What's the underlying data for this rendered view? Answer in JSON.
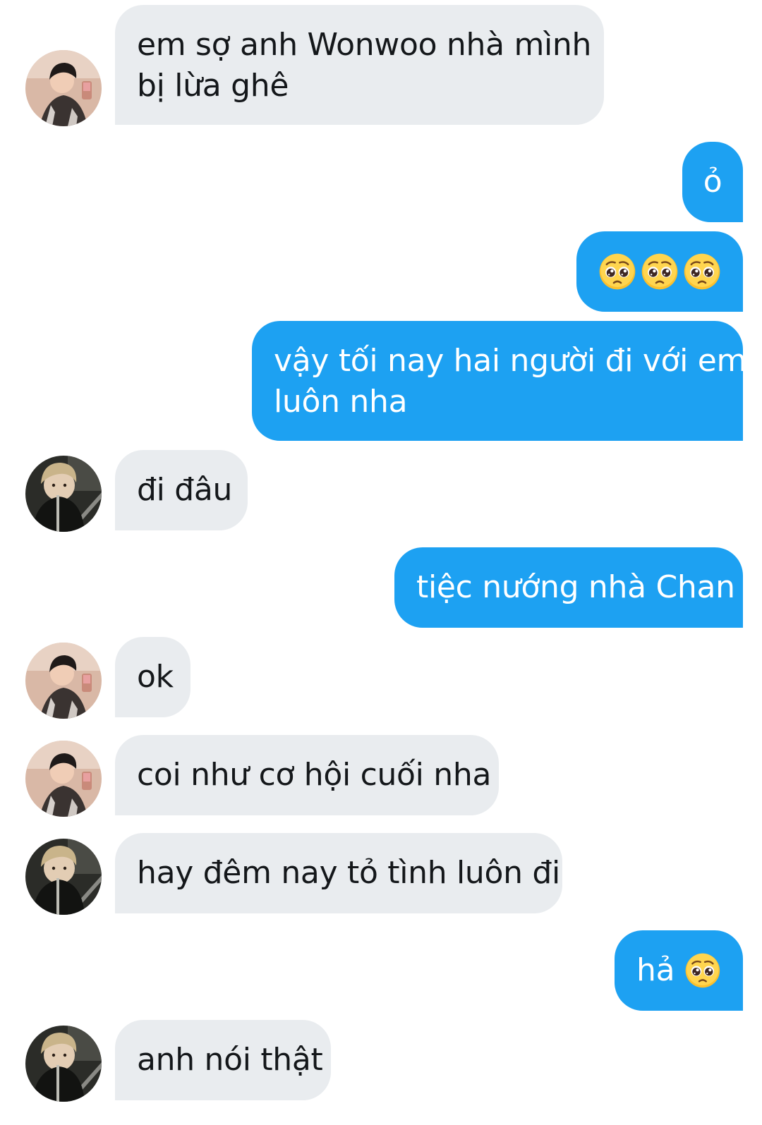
{
  "messages": [
    {
      "side": "in",
      "avatar": "avatar-a",
      "text_lines": [
        "em sợ anh Wonwoo nhà mình",
        "bị lừa ghê"
      ]
    },
    {
      "side": "out",
      "text": "ỏ"
    },
    {
      "side": "out",
      "emojis": [
        "pleading-face",
        "pleading-face",
        "pleading-face"
      ]
    },
    {
      "side": "out",
      "text_lines": [
        "vậy tối nay hai người đi với em",
        "luôn nha"
      ]
    },
    {
      "side": "in",
      "avatar": "avatar-b",
      "text": "đi đâu"
    },
    {
      "side": "out",
      "text": "tiệc nướng nhà Chan"
    },
    {
      "side": "in",
      "avatar": "avatar-a",
      "text": "ok"
    },
    {
      "side": "in",
      "avatar": "avatar-a",
      "text": "coi như cơ hội cuối nha"
    },
    {
      "side": "in",
      "avatar": "avatar-b",
      "text": "hay đêm nay tỏ tình luôn đi"
    },
    {
      "side": "out",
      "text": "hả",
      "emoji": "pleading-face"
    },
    {
      "side": "in",
      "avatar": "avatar-b",
      "text": "anh nói thật"
    }
  ],
  "colors": {
    "incoming_bubble": "#e9ecef",
    "outgoing_bubble": "#1da1f2",
    "incoming_text": "#14171a",
    "outgoing_text": "#ffffff"
  }
}
